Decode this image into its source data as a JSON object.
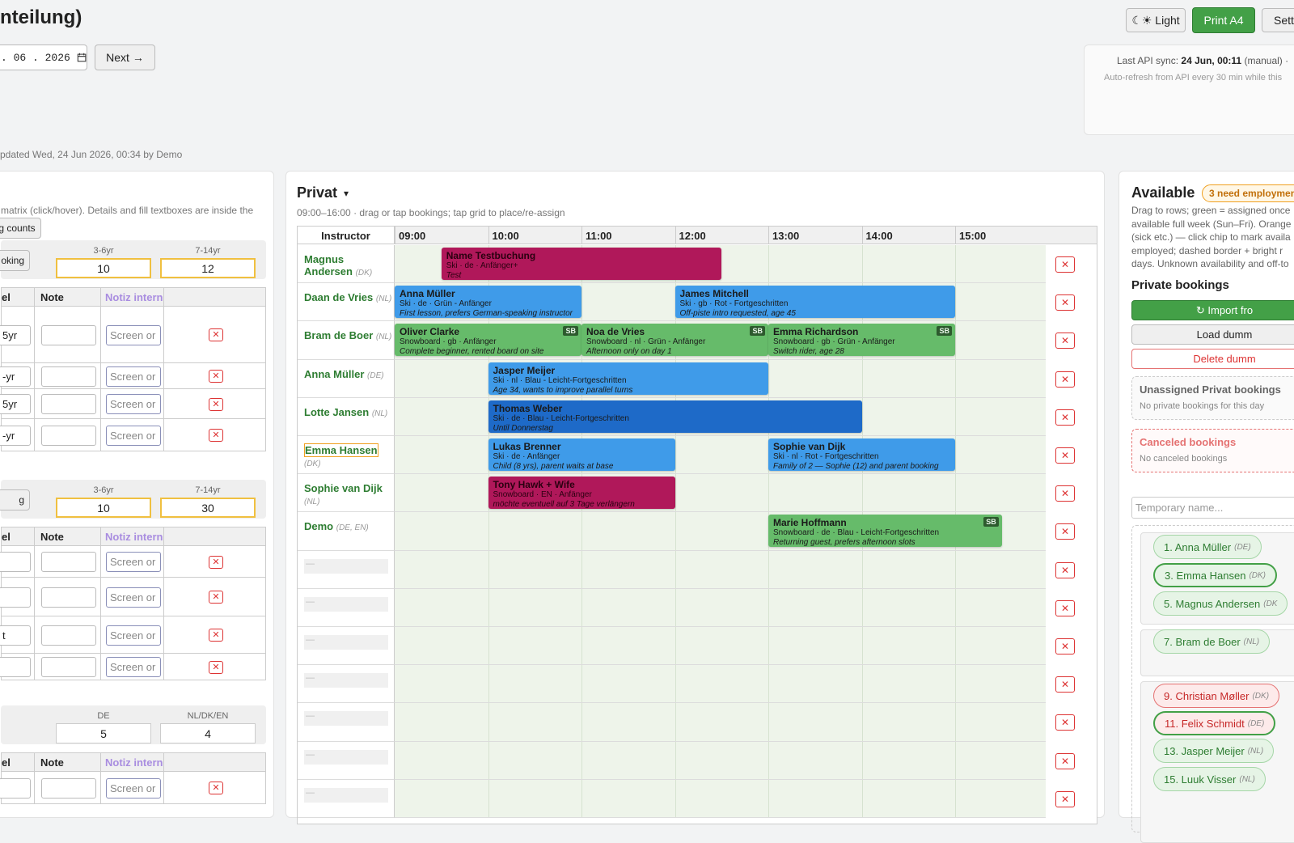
{
  "header": {
    "title": "nteilung)",
    "theme_button": "☾☀ Light",
    "print_button": "Print A4",
    "settings_button": "Sett",
    "date_value": ". 06 . 2026",
    "next_button": "Next →",
    "updated_text": "pdated Wed, 24 Jun 2026, 00:34 by Demo"
  },
  "sync": {
    "label": "Last API sync:",
    "value": "24 Jun, 00:11",
    "mode": "(manual)",
    "sep": "·",
    "auto_refresh": "Auto-refresh from API every 30 min while this"
  },
  "left": {
    "intro": "matrix (click/hover). Details and fill textboxes are inside the",
    "counts_button": "g counts",
    "col_headers": {
      "level": "el",
      "note": "Note",
      "notiz": "Notiz intern"
    },
    "placeholder": "Screen or",
    "groups": [
      {
        "button": "oking",
        "count_labels": [
          "3-6yr",
          "7-14yr"
        ],
        "counts": [
          "10",
          "12"
        ],
        "rows": [
          "5yr",
          "-yr",
          "5yr",
          "-yr"
        ]
      },
      {
        "button": "g",
        "count_labels": [
          "3-6yr",
          "7-14yr"
        ],
        "counts": [
          "10",
          "30"
        ],
        "rows": [
          "",
          "",
          "t",
          ""
        ]
      },
      {
        "button": "",
        "count_labels": [
          "DE",
          "NL/DK/EN"
        ],
        "counts": [
          "5",
          "4"
        ],
        "rows": [
          ""
        ]
      }
    ]
  },
  "schedule": {
    "title": "Privat",
    "dropdown_icon": "▾",
    "subtitle": "09:00–16:00 · drag or tap bookings; tap grid to place/re-assign",
    "instructor_header": "Instructor",
    "hours": [
      "09:00",
      "10:00",
      "11:00",
      "12:00",
      "13:00",
      "14:00",
      "15:00"
    ],
    "empty_placeholder": "—",
    "rows": [
      {
        "name": "Magnus Andersen",
        "lang": "(DK)"
      },
      {
        "name": "Daan de Vries",
        "lang": "(NL)"
      },
      {
        "name": "Bram de Boer",
        "lang": "(NL)"
      },
      {
        "name": "Anna Müller",
        "lang": "(DE)"
      },
      {
        "name": "Lotte Jansen",
        "lang": "(NL)"
      },
      {
        "name": "Emma Hansen",
        "lang": "(DK)"
      },
      {
        "name": "Sophie van Dijk",
        "lang": "(NL)"
      },
      {
        "name": "Demo",
        "lang": "(DE, EN)"
      },
      {
        "name": "",
        "lang": ""
      },
      {
        "name": "",
        "lang": ""
      },
      {
        "name": "",
        "lang": ""
      },
      {
        "name": "",
        "lang": ""
      },
      {
        "name": "",
        "lang": ""
      },
      {
        "name": "",
        "lang": ""
      },
      {
        "name": "",
        "lang": ""
      }
    ],
    "bookings": [
      {
        "row": 0,
        "start": "09:30",
        "end": "12:30",
        "color": "mag",
        "title": "Name Testbuchung",
        "sub": "Ski · de · Anfänger+",
        "note": "Test",
        "sb": ""
      },
      {
        "row": 1,
        "start": "09:00",
        "end": "11:00",
        "color": "blue",
        "title": "Anna Müller",
        "sub": "Ski · de · Grün - Anfänger",
        "note": "First lesson, prefers German-speaking instructor",
        "sb": ""
      },
      {
        "row": 1,
        "start": "12:00",
        "end": "15:00",
        "color": "blue",
        "title": "James Mitchell",
        "sub": "Ski · gb · Rot - Fortgeschritten",
        "note": "Off-piste intro requested, age 45",
        "sb": ""
      },
      {
        "row": 2,
        "start": "09:00",
        "end": "11:00",
        "color": "green",
        "title": "Oliver Clarke",
        "sub": "Snowboard · gb · Anfänger",
        "note": "Complete beginner, rented board on site",
        "sb": "SB"
      },
      {
        "row": 2,
        "start": "11:00",
        "end": "13:00",
        "color": "green",
        "title": "Noa de Vries",
        "sub": "Snowboard · nl · Grün - Anfänger",
        "note": "Afternoon only on day 1",
        "sb": "SB"
      },
      {
        "row": 2,
        "start": "13:00",
        "end": "15:00",
        "color": "green",
        "title": "Emma Richardson",
        "sub": "Snowboard · gb · Grün - Anfänger",
        "note": "Switch rider, age 28",
        "sb": "SB"
      },
      {
        "row": 3,
        "start": "10:00",
        "end": "13:00",
        "color": "blue",
        "title": "Jasper Meijer",
        "sub": "Ski · nl · Blau - Leicht-Fortgeschritten",
        "note": "Age 34, wants to improve parallel turns",
        "sb": ""
      },
      {
        "row": 4,
        "start": "10:00",
        "end": "14:00",
        "color": "dblue",
        "title": "Thomas Weber",
        "sub": "Ski · de · Blau - Leicht-Fortgeschritten",
        "note": "Until Donnerstag",
        "sb": ""
      },
      {
        "row": 5,
        "start": "10:00",
        "end": "12:00",
        "color": "blue",
        "title": "Lukas Brenner",
        "sub": "Ski · de · Anfänger",
        "note": "Child (8 yrs), parent waits at base",
        "sb": ""
      },
      {
        "row": 5,
        "start": "13:00",
        "end": "15:00",
        "color": "blue",
        "title": "Sophie van Dijk",
        "sub": "Ski · nl · Rot - Fortgeschritten",
        "note": "Family of 2 — Sophie (12) and parent booking",
        "sb": ""
      },
      {
        "row": 6,
        "start": "10:00",
        "end": "12:00",
        "color": "mag",
        "title": "Tony Hawk + Wife",
        "sub": "Snowboard · EN · Anfänger",
        "note": "möchte eventuell auf 3 Tage verlängern",
        "sb": ""
      },
      {
        "row": 7,
        "start": "13:00",
        "end": "15:30",
        "color": "green",
        "title": "Marie Hoffmann",
        "sub": "Snowboard · de · Blau - Leicht-Fortgeschritten",
        "note": "Returning guest, prefers afternoon slots",
        "sb": "SB"
      }
    ]
  },
  "right": {
    "title": "Available",
    "badge": "3 need employmen",
    "desc_lines": [
      "Drag to rows; green = assigned once",
      "available full week (Sun–Fri). Orange",
      "(sick etc.) — click chip to mark availa",
      "employed; dashed border + bright r",
      "days. Unknown availability and off-to"
    ],
    "private_title": "Private bookings",
    "import_button": "↻ Import fro",
    "load_button": "Load dumm",
    "delete_button": "Delete dumm",
    "unassigned_title": "Unassigned Privat bookings",
    "unassigned_text": "No private bookings for this day",
    "canceled_title": "Canceled bookings",
    "canceled_text": "No canceled bookings",
    "temp_placeholder": "Temporary name...",
    "chips": [
      {
        "label": "1. Anna Müller",
        "lang": "(DE)",
        "style": "green"
      },
      {
        "label": "3. Emma Hansen",
        "lang": "(DK)",
        "style": "bold"
      },
      {
        "label": "5. Magnus Andersen",
        "lang": "(DK",
        "style": "green"
      },
      {
        "label": "7. Bram de Boer",
        "lang": "(NL)",
        "style": "green"
      },
      {
        "label": "9. Christian Møller",
        "lang": "(DK)",
        "style": "red"
      },
      {
        "label": "11. Felix Schmidt",
        "lang": "(DE)",
        "style": "boldred"
      },
      {
        "label": "13. Jasper Meijer",
        "lang": "(NL)",
        "style": "green"
      },
      {
        "label": "15. Luuk Visser",
        "lang": "(NL)",
        "style": "green"
      }
    ]
  },
  "colors": {
    "accent_green": "#43a047",
    "booking_blue": "#3f9be9",
    "booking_dark_blue": "#1e6ac8",
    "booking_green": "#66bb6a",
    "booking_magenta": "#b0185a",
    "badge_orange": "#f0a020",
    "danger_red": "#d33333"
  }
}
